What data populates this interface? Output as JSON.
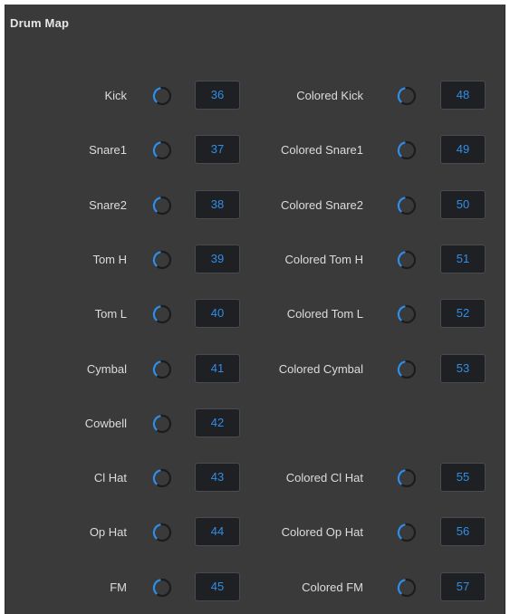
{
  "panel": {
    "title": "Drum Map"
  },
  "colors": {
    "panel_bg": "#3a3a3b",
    "value_text": "#2f8fe8",
    "knob_arc": "#2f8fe8",
    "knob_ring": "#1c1c1e",
    "label_text": "#dcdcdc"
  },
  "left": [
    {
      "label": "Kick",
      "value": "36"
    },
    {
      "label": "Snare1",
      "value": "37"
    },
    {
      "label": "Snare2",
      "value": "38"
    },
    {
      "label": "Tom H",
      "value": "39"
    },
    {
      "label": "Tom L",
      "value": "40"
    },
    {
      "label": "Cymbal",
      "value": "41"
    },
    {
      "label": "Cowbell",
      "value": "42"
    },
    {
      "label": "Cl Hat",
      "value": "43"
    },
    {
      "label": "Op Hat",
      "value": "44"
    },
    {
      "label": "FM",
      "value": "45"
    }
  ],
  "right": [
    {
      "label": "Colored Kick",
      "value": "48"
    },
    {
      "label": "Colored Snare1",
      "value": "49"
    },
    {
      "label": "Colored Snare2",
      "value": "50"
    },
    {
      "label": "Colored Tom H",
      "value": "51"
    },
    {
      "label": "Colored Tom L",
      "value": "52"
    },
    {
      "label": "Colored Cymbal",
      "value": "53"
    },
    null,
    {
      "label": "Colored Cl Hat",
      "value": "55"
    },
    {
      "label": "Colored Op Hat",
      "value": "56"
    },
    {
      "label": "Colored FM",
      "value": "57"
    }
  ],
  "knob_icon": "rotary-knob-icon"
}
